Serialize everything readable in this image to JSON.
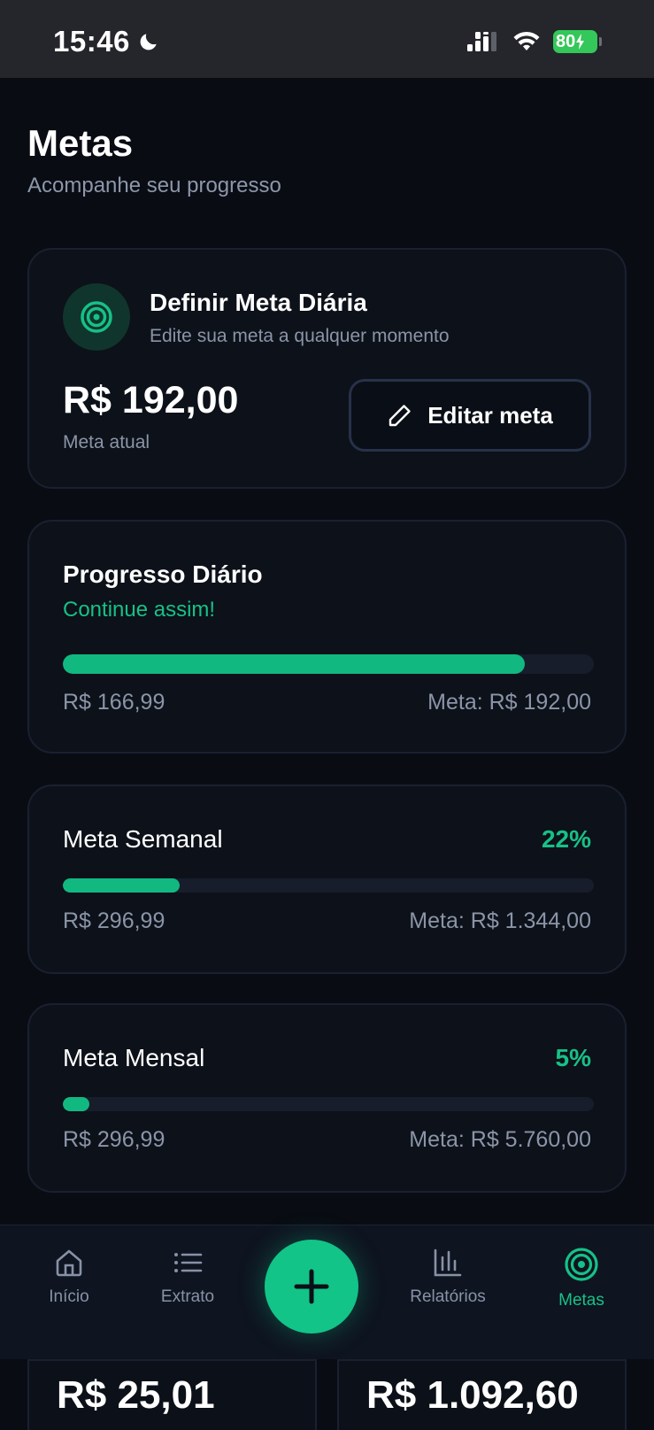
{
  "status_bar": {
    "time": "15:46",
    "battery": "80"
  },
  "header": {
    "title": "Metas",
    "subtitle": "Acompanhe seu progresso"
  },
  "daily_goal_card": {
    "title": "Definir Meta Diária",
    "subtitle": "Edite sua meta a qualquer momento",
    "value": "R$ 192,00",
    "value_label": "Meta atual",
    "edit_button_label": "Editar meta",
    "icon": "target-icon"
  },
  "daily_progress": {
    "title": "Progresso Diário",
    "message": "Continue assim!",
    "current": "R$ 166,99",
    "target": "Meta: R$ 192,00",
    "progress": 0.87
  },
  "weekly_goal": {
    "title": "Meta Semanal",
    "percent": "22%",
    "current": "R$ 296,99",
    "target": "Meta: R$ 1.344,00",
    "progress": 0.22
  },
  "monthly_goal": {
    "title": "Meta Mensal",
    "percent": "5%",
    "current": "R$ 296,99",
    "target": "Meta: R$ 5.760,00",
    "progress": 0.05
  },
  "bottom_nav": {
    "items": [
      {
        "label": "Início",
        "icon": "home-icon"
      },
      {
        "label": "Extrato",
        "icon": "list-icon"
      },
      {
        "label": "Relatórios",
        "icon": "bar-chart-icon"
      },
      {
        "label": "Metas",
        "icon": "target-icon",
        "active": true
      }
    ],
    "fab_icon": "plus-icon"
  },
  "peek_cards": {
    "left_value": "R$ 25,01",
    "right_value": "R$ 1.092,60"
  },
  "colors": {
    "background": "#090c13",
    "card": "#0d1119",
    "accent": "#16c187",
    "muted_text": "#8b95a8"
  }
}
